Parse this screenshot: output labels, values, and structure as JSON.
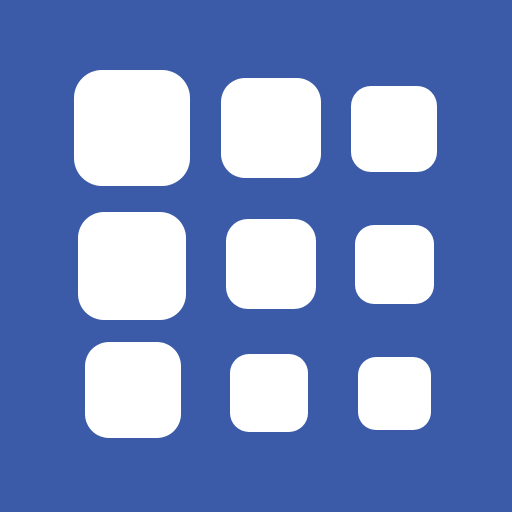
{
  "icon": {
    "name": "grid-of-rounded-squares-icon",
    "background_color": "#3b5ba9",
    "tile_color": "#ffffff",
    "rows": 3,
    "columns": 3
  }
}
